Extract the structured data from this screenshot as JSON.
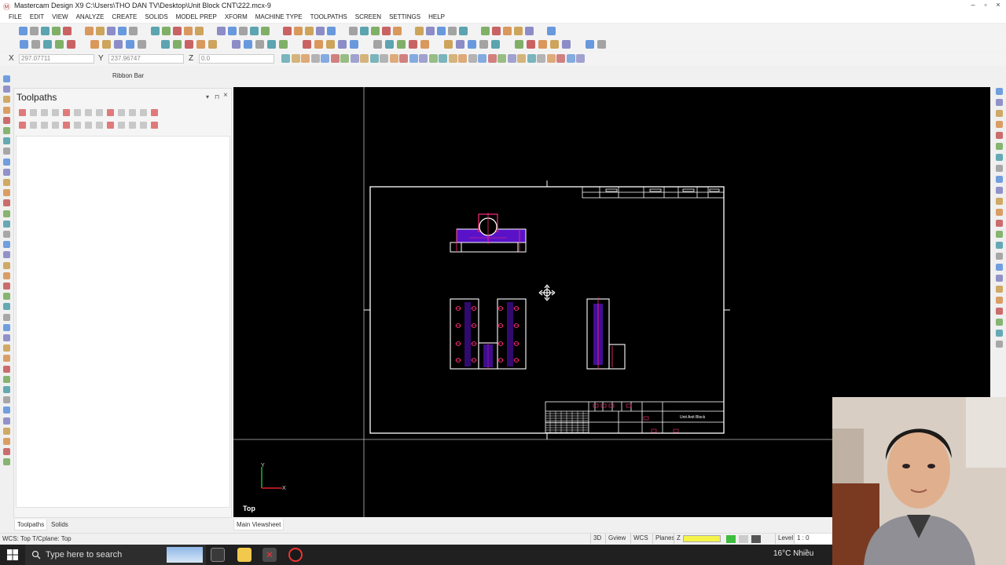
{
  "window": {
    "title": "Mastercam Design X9  C:\\Users\\THO DAN TV\\Desktop\\Unit Block CNT\\222.mcx-9",
    "controls": [
      "–",
      "▫",
      "×"
    ]
  },
  "menu": [
    "FILE",
    "EDIT",
    "VIEW",
    "ANALYZE",
    "CREATE",
    "SOLIDS",
    "MODEL PREP",
    "XFORM",
    "MACHINE TYPE",
    "TOOLPATHS",
    "SCREEN",
    "SETTINGS",
    "HELP"
  ],
  "coords": {
    "x_label": "X",
    "x_value": "297.07711",
    "y_label": "Y",
    "y_value": "237.96747",
    "z_label": "Z",
    "z_value": "0.0"
  },
  "ribbon_bar_label": "Ribbon Bar",
  "panel": {
    "title": "Toolpaths",
    "tabs": [
      "Toolpaths",
      "Solids"
    ]
  },
  "viewport": {
    "view_label": "Top",
    "tab": "Main Viewsheet",
    "axis_y": "Y",
    "axis_x": "X",
    "title_block_text": "Unit Anit Block"
  },
  "status": {
    "text": "WCS: Top  T/Cplane: Top",
    "buttons": [
      "3D",
      "Gview",
      "WCS",
      "Planes",
      "Z",
      "Level",
      "1 : 0"
    ]
  },
  "taskbar": {
    "search_placeholder": "Type here to search",
    "weather": "16°C  Nhiều"
  },
  "colors": {
    "viewport_bg": "#000000",
    "geometry": "#ffffff",
    "dims": "#ff2d7a",
    "hatch": "#5a12c8"
  }
}
